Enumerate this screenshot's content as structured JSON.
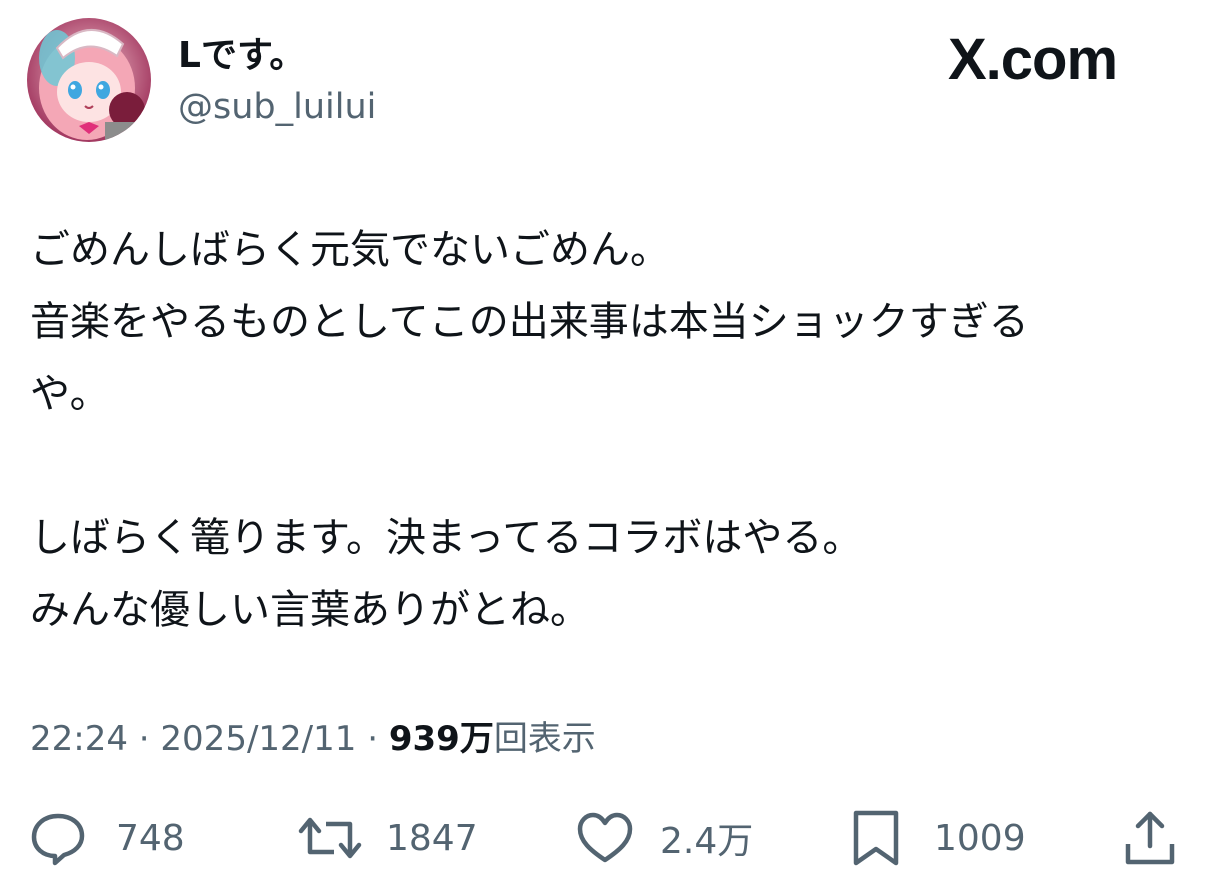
{
  "author": {
    "display_name": "Lです。",
    "handle": "@sub_luilui"
  },
  "brand": {
    "name": "X.com"
  },
  "post": {
    "lines": [
      "ごめんしばらく元気でないごめん。",
      "音楽をやるものとしてこの出来事は本当ショックすぎる",
      "や。",
      "",
      "しばらく篭ります。決まってるコラボはやる。",
      "みんな優しい言葉ありがとね。"
    ]
  },
  "meta": {
    "time": "22:24",
    "separator1": " · ",
    "date": "2025/12/11",
    "separator2": " · ",
    "views_count": "939",
    "views_unit": "万",
    "views_label": "回表示"
  },
  "actions": {
    "replies": {
      "icon": "reply-icon",
      "count": "748"
    },
    "reposts": {
      "icon": "repost-icon",
      "count": "1847"
    },
    "likes": {
      "icon": "heart-icon",
      "count": "2.4万"
    },
    "bookmarks": {
      "icon": "bookmark-icon",
      "count": "1009"
    },
    "share": {
      "icon": "share-icon"
    }
  },
  "colors": {
    "text": "#0f1419",
    "secondary": "#536471",
    "background": "#ffffff"
  }
}
